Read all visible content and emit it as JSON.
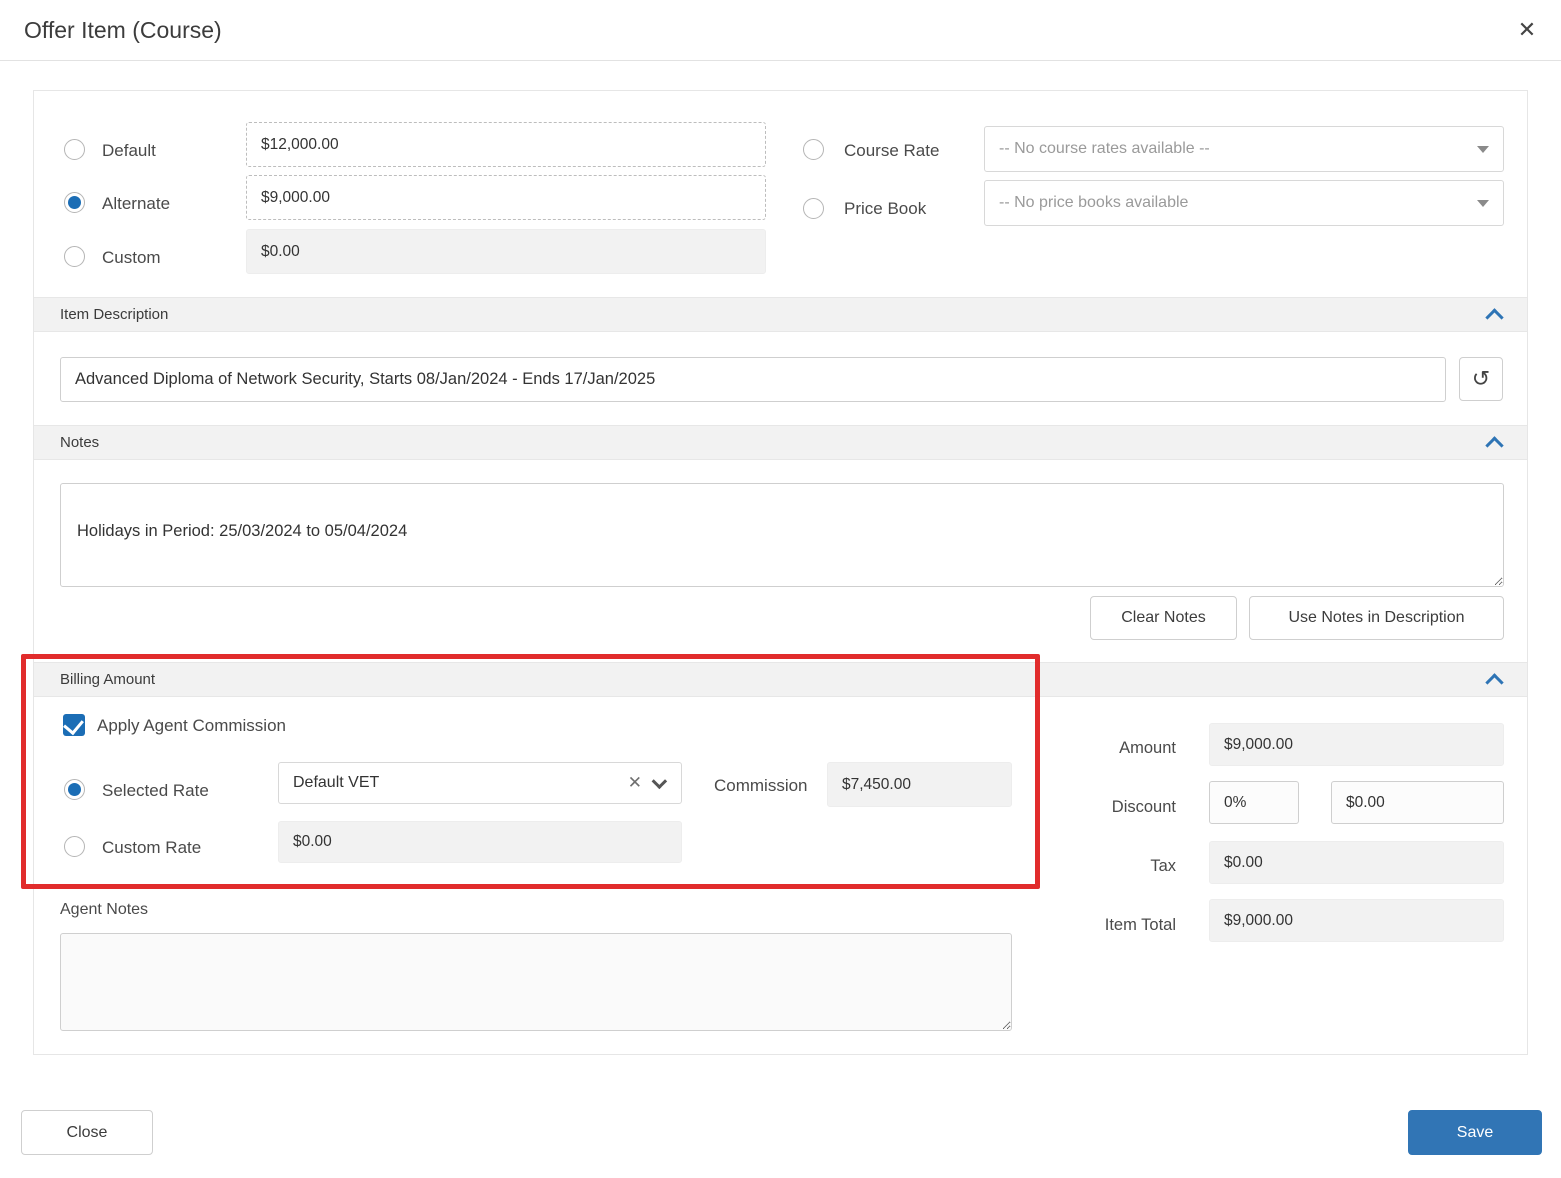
{
  "modal": {
    "title": "Offer Item (Course)"
  },
  "icons": {
    "close": "✕",
    "history": "↺",
    "clear": "✕"
  },
  "pricing": {
    "options": [
      {
        "label": "Default",
        "value": "$12,000.00",
        "selected": false
      },
      {
        "label": "Alternate",
        "value": "$9,000.00",
        "selected": true
      },
      {
        "label": "Custom",
        "value": "$0.00",
        "selected": false
      }
    ],
    "course_rate": {
      "label": "Course Rate",
      "placeholder": "-- No course rates available --"
    },
    "price_book": {
      "label": "Price Book",
      "placeholder": "-- No price books available"
    }
  },
  "item_description": {
    "header": "Item Description",
    "value": "Advanced Diploma of Network Security, Starts 08/Jan/2024 - Ends 17/Jan/2025"
  },
  "notes": {
    "header": "Notes",
    "value": "Holidays in Period: 25/03/2024 to 05/04/2024",
    "clear_button": "Clear Notes",
    "use_button": "Use Notes in Description"
  },
  "billing": {
    "header": "Billing Amount",
    "apply_commission_label": "Apply Agent Commission",
    "selected_rate_label": "Selected Rate",
    "rate_value": "Default VET",
    "commission_label": "Commission",
    "commission_value": "$7,450.00",
    "custom_rate_label": "Custom Rate",
    "custom_rate_value": "$0.00"
  },
  "summary": {
    "amount_label": "Amount",
    "amount_value": "$9,000.00",
    "discount_label": "Discount",
    "discount_percent": "0%",
    "discount_value": "$0.00",
    "tax_label": "Tax",
    "tax_value": "$0.00",
    "item_total_label": "Item Total",
    "item_total_value": "$9,000.00"
  },
  "agent_notes": {
    "label": "Agent Notes",
    "value": ""
  },
  "footer": {
    "close_label": "Close",
    "save_label": "Save"
  },
  "colors": {
    "accent_blue": "#3175b5",
    "annotation_red": "#e12c2c",
    "section_bar": "#f2f2f2"
  }
}
